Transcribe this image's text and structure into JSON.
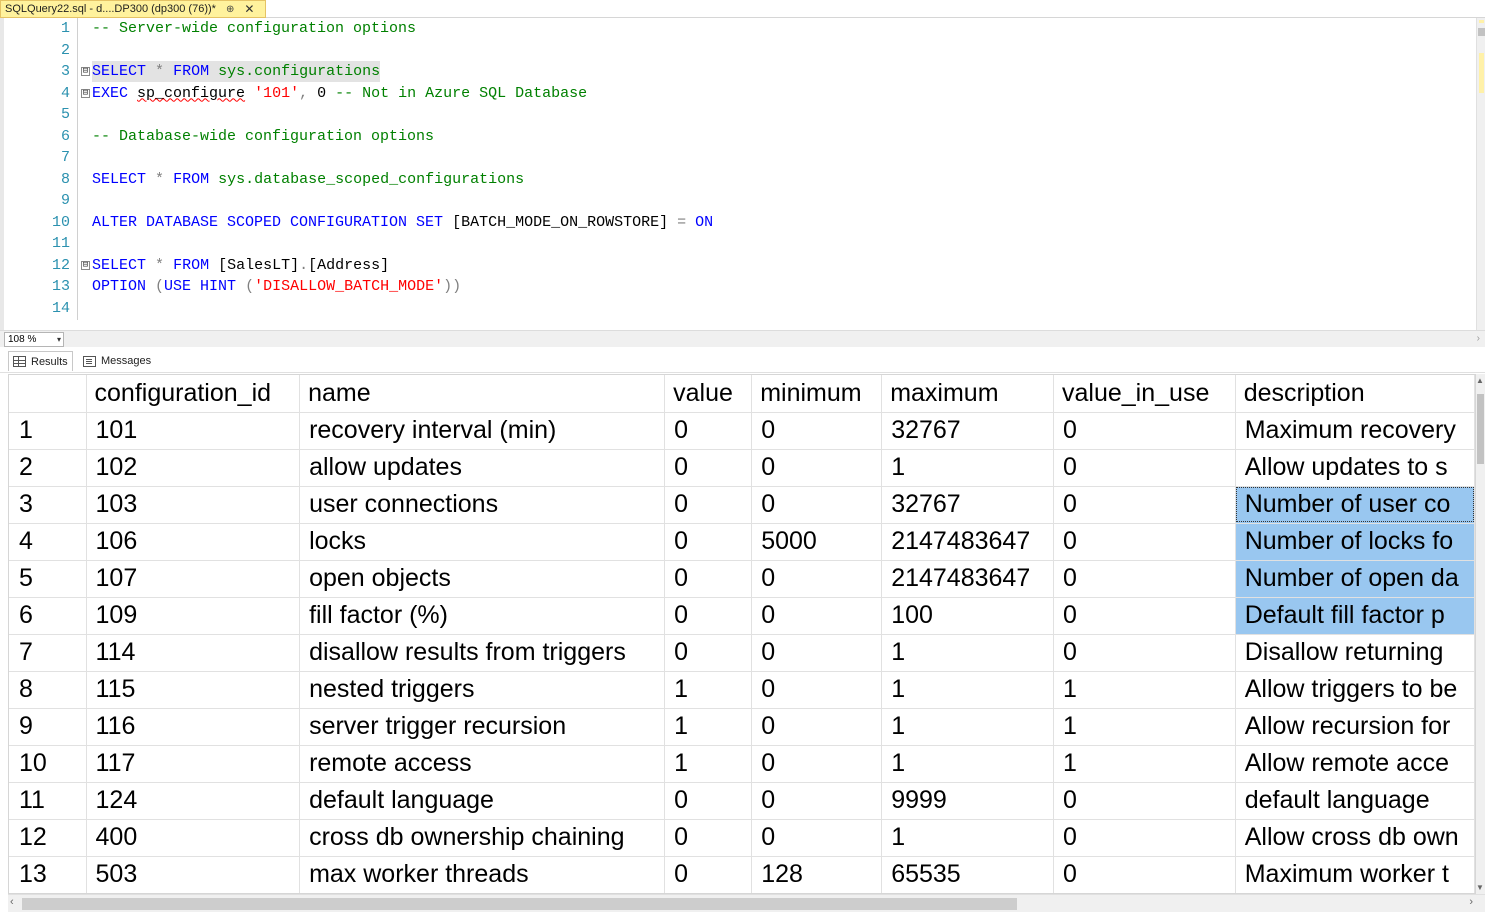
{
  "tab": {
    "title": "SQLQuery22.sql - d....DP300 (dp300 (76))*",
    "pin_icon": "pin-icon",
    "close_icon": "close-icon"
  },
  "editor": {
    "lines": [
      {
        "n": "1",
        "segments": [
          {
            "t": "-- Server-wide configuration options",
            "c": "cm"
          }
        ]
      },
      {
        "n": "2",
        "segments": []
      },
      {
        "n": "3",
        "fold": "⊟",
        "segments": [
          {
            "t": "SELECT",
            "c": "kw"
          },
          {
            "t": " ",
            "c": "pl"
          },
          {
            "t": "*",
            "c": "op"
          },
          {
            "t": " ",
            "c": "pl"
          },
          {
            "t": "FROM",
            "c": "kw"
          },
          {
            "t": " ",
            "c": "pl"
          },
          {
            "t": "sys.configurations",
            "c": "sy"
          }
        ]
      },
      {
        "n": "4",
        "fold": "⊟",
        "segments": [
          {
            "t": "EXEC",
            "c": "kw"
          },
          {
            "t": " ",
            "c": "pl"
          },
          {
            "t": "sp_configure",
            "c": "pl squig"
          },
          {
            "t": " ",
            "c": "pl"
          },
          {
            "t": "'101'",
            "c": "st"
          },
          {
            "t": ",",
            "c": "op"
          },
          {
            "t": " 0 ",
            "c": "pl"
          },
          {
            "t": "-- Not in Azure SQL Database",
            "c": "cm"
          }
        ]
      },
      {
        "n": "5",
        "segments": []
      },
      {
        "n": "6",
        "segments": [
          {
            "t": "-- Database-wide configuration options",
            "c": "cm"
          }
        ]
      },
      {
        "n": "7",
        "segments": []
      },
      {
        "n": "8",
        "segments": [
          {
            "t": "SELECT",
            "c": "kw"
          },
          {
            "t": " ",
            "c": "pl"
          },
          {
            "t": "*",
            "c": "op"
          },
          {
            "t": " ",
            "c": "pl"
          },
          {
            "t": "FROM",
            "c": "kw"
          },
          {
            "t": " ",
            "c": "pl"
          },
          {
            "t": "sys.database_scoped_configurations",
            "c": "sy"
          }
        ]
      },
      {
        "n": "9",
        "segments": []
      },
      {
        "n": "10",
        "segments": [
          {
            "t": "ALTER DATABASE SCOPED CONFIGURATION SET",
            "c": "kw"
          },
          {
            "t": " [BATCH_MODE_ON_ROWSTORE] ",
            "c": "pl"
          },
          {
            "t": "=",
            "c": "op"
          },
          {
            "t": " ",
            "c": "pl"
          },
          {
            "t": "ON",
            "c": "kw"
          }
        ]
      },
      {
        "n": "11",
        "segments": []
      },
      {
        "n": "12",
        "fold": "⊟",
        "segments": [
          {
            "t": "SELECT",
            "c": "kw"
          },
          {
            "t": " ",
            "c": "pl"
          },
          {
            "t": "*",
            "c": "op"
          },
          {
            "t": " ",
            "c": "pl"
          },
          {
            "t": "FROM",
            "c": "kw"
          },
          {
            "t": " [SalesLT]",
            "c": "pl"
          },
          {
            "t": ".",
            "c": "op"
          },
          {
            "t": "[Address]",
            "c": "pl"
          }
        ]
      },
      {
        "n": "13",
        "segments": [
          {
            "t": "OPTION",
            "c": "kw"
          },
          {
            "t": " ",
            "c": "pl"
          },
          {
            "t": "(",
            "c": "op"
          },
          {
            "t": "USE HINT",
            "c": "kw"
          },
          {
            "t": " ",
            "c": "pl"
          },
          {
            "t": "(",
            "c": "op"
          },
          {
            "t": "'DISALLOW_BATCH_MODE'",
            "c": "st"
          },
          {
            "t": "))",
            "c": "op"
          }
        ]
      },
      {
        "n": "14",
        "segments": []
      }
    ]
  },
  "zoom": {
    "value": "108 %"
  },
  "results_tabs": [
    {
      "label": "Results",
      "icon": "grid-icon"
    },
    {
      "label": "Messages",
      "icon": "messages-icon"
    }
  ],
  "grid": {
    "columns": [
      "",
      "configuration_id",
      "name",
      "value",
      "minimum",
      "maximum",
      "value_in_use",
      "description"
    ],
    "rows": [
      [
        "1",
        "101",
        "recovery interval (min)",
        "0",
        "0",
        "32767",
        "0",
        "Maximum recovery"
      ],
      [
        "2",
        "102",
        "allow updates",
        "0",
        "0",
        "1",
        "0",
        "Allow updates to s"
      ],
      [
        "3",
        "103",
        "user connections",
        "0",
        "0",
        "32767",
        "0",
        "Number of user co"
      ],
      [
        "4",
        "106",
        "locks",
        "0",
        "5000",
        "2147483647",
        "0",
        "Number of locks fo"
      ],
      [
        "5",
        "107",
        "open objects",
        "0",
        "0",
        "2147483647",
        "0",
        "Number of open da"
      ],
      [
        "6",
        "109",
        "fill factor (%)",
        "0",
        "0",
        "100",
        "0",
        "Default fill factor p"
      ],
      [
        "7",
        "114",
        "disallow results from triggers",
        "0",
        "0",
        "1",
        "0",
        "Disallow returning"
      ],
      [
        "8",
        "115",
        "nested triggers",
        "1",
        "0",
        "1",
        "1",
        "Allow triggers to be"
      ],
      [
        "9",
        "116",
        "server trigger recursion",
        "1",
        "0",
        "1",
        "1",
        "Allow recursion for"
      ],
      [
        "10",
        "117",
        "remote access",
        "1",
        "0",
        "1",
        "1",
        "Allow remote acce"
      ],
      [
        "11",
        "124",
        "default language",
        "0",
        "0",
        "9999",
        "0",
        "default language"
      ],
      [
        "12",
        "400",
        "cross db ownership chaining",
        "0",
        "0",
        "1",
        "0",
        "Allow cross db own"
      ],
      [
        "13",
        "503",
        "max worker threads",
        "0",
        "128",
        "65535",
        "0",
        "Maximum worker t"
      ]
    ],
    "selected_rows": [
      2,
      3,
      4,
      5
    ],
    "selected_column": 7
  },
  "colors": {
    "tab_active": "#fff29d",
    "selection": "#99c7f0",
    "keyword": "#0000ff",
    "comment": "#008000",
    "string": "#ff0000",
    "line_number": "#2b91af"
  }
}
